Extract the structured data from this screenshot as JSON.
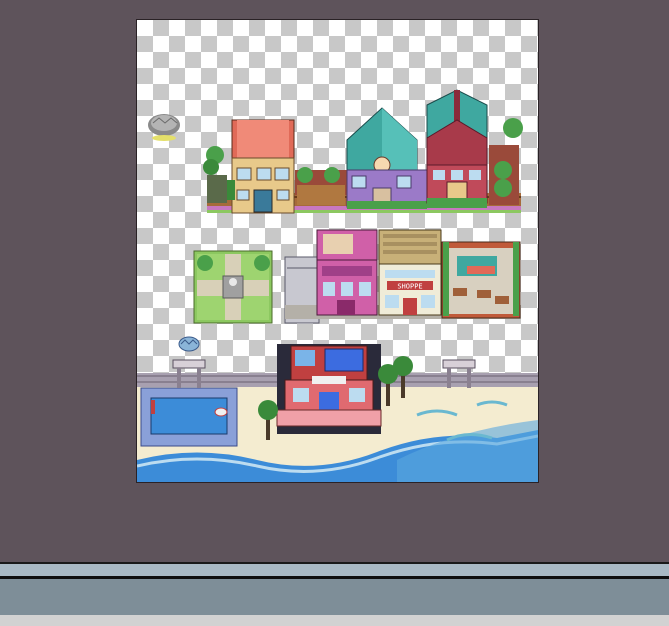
{
  "canvas": {
    "background": "#5e535b",
    "checker_light": "#ffffff",
    "checker_dark": "#c8c8c8"
  },
  "tileset": {
    "sign_text": "SHOPPE",
    "colors": {
      "roof_red": "#e06a58",
      "roof_teal": "#3fa8a0",
      "roof_maroon": "#8a2a3a",
      "wall_tan": "#e8c98a",
      "wall_purple": "#9b7ac8",
      "wall_pink": "#d060a8",
      "grass": "#8cc860",
      "water": "#3c8cd8",
      "sand": "#f4ecd0",
      "fence": "#8a5a3a",
      "brick": "#c04040"
    }
  },
  "status_bar": {
    "color": "#7e8e98",
    "strip_color": "#a9b9c4"
  }
}
